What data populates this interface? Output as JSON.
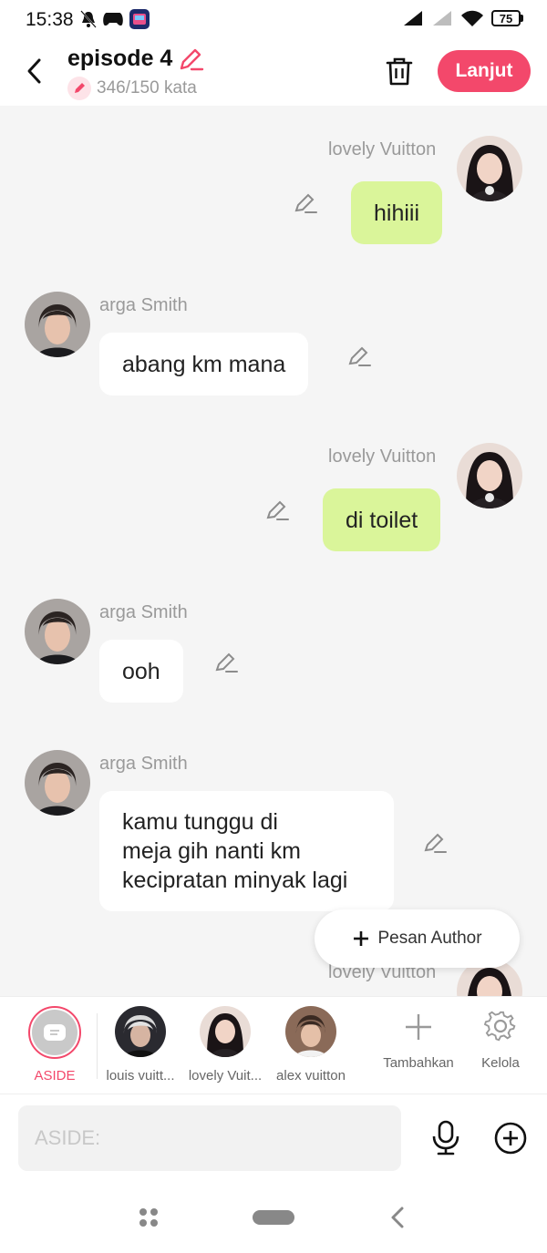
{
  "status_bar": {
    "time": "15:38",
    "battery": "75"
  },
  "header": {
    "title": "episode 4",
    "word_count": "346/150 kata",
    "next_label": "Lanjut"
  },
  "messages": [
    {
      "sender": "lovely Vuitton",
      "side": "right",
      "text": "hihiii"
    },
    {
      "sender": "arga Smith",
      "side": "left",
      "text": "abang km mana"
    },
    {
      "sender": "lovely Vuitton",
      "side": "right",
      "text": "di toilet"
    },
    {
      "sender": "arga Smith",
      "side": "left",
      "text": "ooh"
    },
    {
      "sender": "arga Smith",
      "side": "left",
      "lines": [
        "kamu tunggu di",
        "meja gih nanti km",
        "kecipratan minyak lagi"
      ]
    },
    {
      "sender": "lovely Vuitton",
      "side": "right"
    }
  ],
  "author_button": "Pesan Author",
  "characters": {
    "aside": "ASIDE",
    "louis": "louis vuitt...",
    "lovely": "lovely Vuit...",
    "alex": "alex vuitton",
    "add": "Tambahkan",
    "manage": "Kelola"
  },
  "input": {
    "placeholder": "ASIDE:"
  },
  "colors": {
    "accent": "#f3486b",
    "bubble_right": "#daf59a",
    "bubble_left": "#ffffff",
    "chat_bg": "#f5f5f5"
  },
  "icons": [
    "back-arrow-icon",
    "pencil-icon",
    "trash-icon",
    "microphone-icon",
    "plus-circle-icon",
    "gear-icon",
    "plus-icon",
    "home-pill-icon",
    "apps-icon",
    "nav-back-icon"
  ]
}
